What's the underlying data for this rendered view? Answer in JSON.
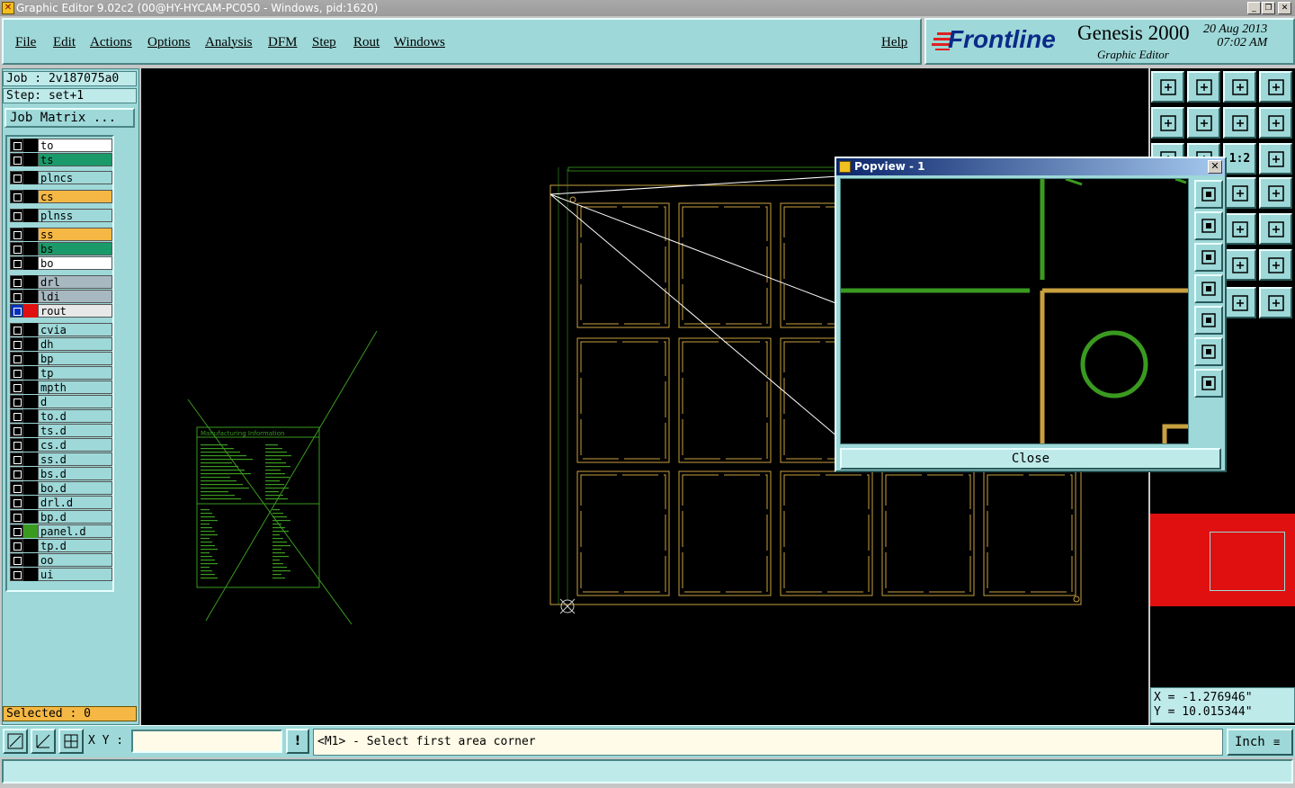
{
  "window": {
    "title": "Graphic Editor 9.02c2 (00@HY-HYCAM-PC050 - Windows, pid:1620)"
  },
  "menu": [
    "File",
    "Edit",
    "Actions",
    "Options",
    "Analysis",
    "DFM",
    "Step",
    "Rout",
    "Windows"
  ],
  "help": "Help",
  "brand": {
    "logo": "Frontline",
    "product": "Genesis 2000",
    "subtitle": "Graphic Editor",
    "date": "20 Aug 2013",
    "time": "07:02 AM"
  },
  "job": {
    "job_label": "Job : 2v187075a0",
    "step_label": "Step: set+1",
    "matrix_button": "Job Matrix ..."
  },
  "layers": [
    {
      "name": "to",
      "bg": "#ffffff",
      "color": "#000000"
    },
    {
      "name": "ts",
      "bg": "#1a9a6a",
      "color": "#000000"
    },
    {
      "name": "plncs",
      "bg": "#9ed8d8",
      "color": "#000000"
    },
    {
      "name": "cs",
      "bg": "#f5b845",
      "color": "#000000"
    },
    {
      "name": "plnss",
      "bg": "#9ed8d8",
      "color": "#000000"
    },
    {
      "name": "ss",
      "bg": "#f5b845",
      "color": "#000000"
    },
    {
      "name": "bs",
      "bg": "#1a9a6a",
      "color": "#000000"
    },
    {
      "name": "bo",
      "bg": "#ffffff",
      "color": "#000000"
    },
    {
      "name": "drl",
      "bg": "#a8b8c0",
      "color": "#000000"
    },
    {
      "name": "ldi",
      "bg": "#a8b8c0",
      "color": "#000000"
    },
    {
      "name": "rout",
      "bg": "#e8e8e8",
      "color": "#ff0000"
    },
    {
      "name": "cvia",
      "bg": "#9ed8d8",
      "color": "#000000"
    },
    {
      "name": "dh",
      "bg": "#9ed8d8",
      "color": "#000000"
    },
    {
      "name": "bp",
      "bg": "#9ed8d8",
      "color": "#000000"
    },
    {
      "name": "tp",
      "bg": "#9ed8d8",
      "color": "#000000"
    },
    {
      "name": "mpth",
      "bg": "#9ed8d8",
      "color": "#000000"
    },
    {
      "name": "d",
      "bg": "#9ed8d8",
      "color": "#000000"
    },
    {
      "name": "to.d",
      "bg": "#9ed8d8",
      "color": "#000000"
    },
    {
      "name": "ts.d",
      "bg": "#9ed8d8",
      "color": "#000000"
    },
    {
      "name": "cs.d",
      "bg": "#9ed8d8",
      "color": "#000000"
    },
    {
      "name": "ss.d",
      "bg": "#9ed8d8",
      "color": "#000000"
    },
    {
      "name": "bs.d",
      "bg": "#9ed8d8",
      "color": "#000000"
    },
    {
      "name": "bo.d",
      "bg": "#9ed8d8",
      "color": "#000000"
    },
    {
      "name": "drl.d",
      "bg": "#9ed8d8",
      "color": "#000000"
    },
    {
      "name": "bp.d",
      "bg": "#9ed8d8",
      "color": "#000000"
    },
    {
      "name": "panel.d",
      "bg": "#9ed8d8",
      "color": "#2a8a1a"
    },
    {
      "name": "tp.d",
      "bg": "#9ed8d8",
      "color": "#000000"
    },
    {
      "name": "oo",
      "bg": "#9ed8d8",
      "color": "#000000"
    },
    {
      "name": "ui",
      "bg": "#9ed8d8",
      "color": "#000000"
    }
  ],
  "selected": "Selected : 0",
  "canvas": {
    "mfg_title": "Manufacturing Information"
  },
  "popview": {
    "title": "Popview - 1",
    "close": "Close"
  },
  "coords": {
    "x": "X = -1.276946\"",
    "y": "Y = 10.015344\""
  },
  "bottom": {
    "xy_label": "X Y :",
    "xy_value": "",
    "prompt": "<M1> - Select first area corner",
    "unit": "Inch"
  },
  "toolbar_ratio": "1:2"
}
